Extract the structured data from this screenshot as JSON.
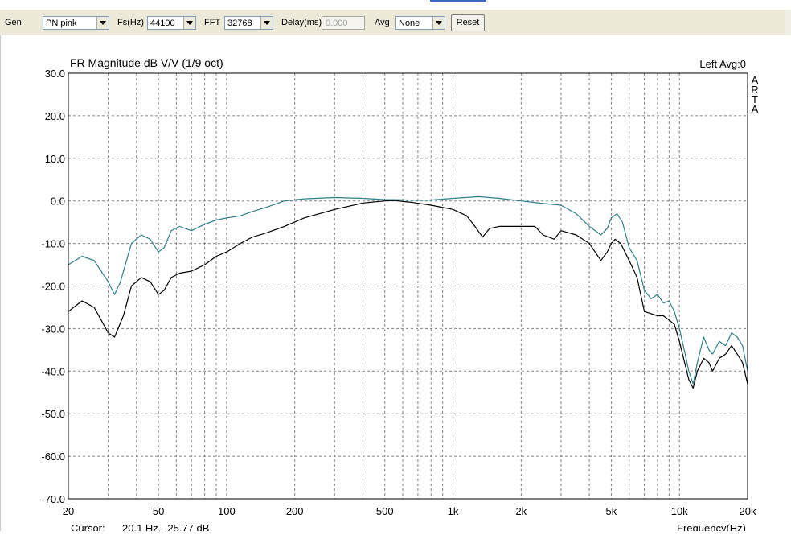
{
  "toolbar": {
    "gen_label": "Gen",
    "gen_value": "PN pink",
    "fs_label": "Fs(Hz)",
    "fs_value": "44100",
    "fft_label": "FFT",
    "fft_value": "32768",
    "delay_label": "Delay(ms)",
    "delay_value": "0.000",
    "avg_label": "Avg",
    "avg_value": "None",
    "reset_label": "Reset"
  },
  "chart": {
    "title": "FR Magnitude dB V/V (1/9 oct)",
    "status": "Left  Avg:0",
    "watermark": [
      "A",
      "R",
      "T",
      "A"
    ],
    "cursor_label": "Cursor:",
    "cursor_value": "20.1 Hz, -25.77 dB",
    "xlabel": "Frequency(Hz)"
  },
  "colors": {
    "grid": "#808080",
    "series_black": "#000000",
    "series_teal": "#2e7f86",
    "axis": "#000000"
  },
  "chart_data": {
    "type": "line",
    "title": "FR Magnitude dB V/V (1/9 oct)",
    "xlabel": "Frequency(Hz)",
    "ylabel": "",
    "xscale": "log",
    "xlim": [
      20,
      20000
    ],
    "ylim": [
      -70,
      30
    ],
    "grid": true,
    "x_ticks": [
      20,
      50,
      100,
      200,
      500,
      1000,
      2000,
      5000,
      10000,
      20000
    ],
    "x_tick_labels": [
      "20",
      "50",
      "100",
      "200",
      "500",
      "1k",
      "2k",
      "5k",
      "10k",
      "20k"
    ],
    "y_ticks": [
      30,
      20,
      10,
      0,
      -10,
      -20,
      -30,
      -40,
      -50,
      -60,
      -70
    ],
    "y_tick_labels": [
      "30.0",
      "20.0",
      "10.0",
      "0.0",
      "-10.0",
      "-20.0",
      "-30.0",
      "-40.0",
      "-50.0",
      "-60.0",
      "-70.0"
    ],
    "series": [
      {
        "color": "#2e7f86",
        "points": [
          [
            20,
            -15
          ],
          [
            23,
            -13
          ],
          [
            26,
            -14
          ],
          [
            30,
            -19
          ],
          [
            32,
            -22
          ],
          [
            34,
            -19
          ],
          [
            38,
            -10
          ],
          [
            42,
            -8
          ],
          [
            46,
            -9
          ],
          [
            50,
            -12
          ],
          [
            53,
            -11
          ],
          [
            57,
            -7
          ],
          [
            62,
            -6
          ],
          [
            70,
            -7
          ],
          [
            80,
            -5.5
          ],
          [
            90,
            -4.5
          ],
          [
            100,
            -4
          ],
          [
            115,
            -3.5
          ],
          [
            130,
            -2.5
          ],
          [
            150,
            -1.5
          ],
          [
            180,
            0
          ],
          [
            220,
            0.5
          ],
          [
            300,
            0.8
          ],
          [
            400,
            0.6
          ],
          [
            500,
            0.3
          ],
          [
            550,
            0.3
          ],
          [
            650,
            0.2
          ],
          [
            800,
            0.2
          ],
          [
            1000,
            0.6
          ],
          [
            1300,
            1
          ],
          [
            1600,
            0.6
          ],
          [
            2000,
            0
          ],
          [
            2500,
            -0.6
          ],
          [
            3000,
            -1
          ],
          [
            3500,
            -3
          ],
          [
            4000,
            -6
          ],
          [
            4500,
            -8
          ],
          [
            4800,
            -6.5
          ],
          [
            5000,
            -4
          ],
          [
            5300,
            -3
          ],
          [
            5600,
            -5
          ],
          [
            6000,
            -11
          ],
          [
            6500,
            -14
          ],
          [
            7000,
            -21
          ],
          [
            7500,
            -23
          ],
          [
            8000,
            -22
          ],
          [
            8500,
            -24
          ],
          [
            9000,
            -23.5
          ],
          [
            9500,
            -26
          ],
          [
            10000,
            -30
          ],
          [
            10500,
            -35
          ],
          [
            11000,
            -40
          ],
          [
            11500,
            -43
          ],
          [
            12000,
            -38
          ],
          [
            12800,
            -32
          ],
          [
            13500,
            -35
          ],
          [
            14000,
            -36
          ],
          [
            15000,
            -33
          ],
          [
            16000,
            -34
          ],
          [
            17000,
            -31
          ],
          [
            18000,
            -32
          ],
          [
            19000,
            -34
          ],
          [
            20000,
            -40
          ]
        ]
      },
      {
        "color": "#000000",
        "points": [
          [
            20,
            -26
          ],
          [
            23,
            -23.5
          ],
          [
            26,
            -25
          ],
          [
            30,
            -31
          ],
          [
            32,
            -32
          ],
          [
            35,
            -27
          ],
          [
            38,
            -20
          ],
          [
            42,
            -18
          ],
          [
            46,
            -19
          ],
          [
            50,
            -22
          ],
          [
            53,
            -21
          ],
          [
            57,
            -18
          ],
          [
            62,
            -17
          ],
          [
            70,
            -16.5
          ],
          [
            80,
            -15
          ],
          [
            90,
            -13
          ],
          [
            100,
            -12
          ],
          [
            115,
            -10
          ],
          [
            130,
            -8.5
          ],
          [
            150,
            -7.5
          ],
          [
            180,
            -6
          ],
          [
            220,
            -4
          ],
          [
            300,
            -2
          ],
          [
            400,
            -0.5
          ],
          [
            500,
            0
          ],
          [
            550,
            0.1
          ],
          [
            650,
            -0.3
          ],
          [
            800,
            -1
          ],
          [
            1000,
            -2
          ],
          [
            1150,
            -3.5
          ],
          [
            1250,
            -6
          ],
          [
            1350,
            -8.5
          ],
          [
            1450,
            -6.5
          ],
          [
            1600,
            -6
          ],
          [
            2000,
            -6
          ],
          [
            2300,
            -6
          ],
          [
            2500,
            -8
          ],
          [
            2800,
            -9
          ],
          [
            3000,
            -7
          ],
          [
            3500,
            -8
          ],
          [
            4000,
            -10
          ],
          [
            4500,
            -14
          ],
          [
            4800,
            -12
          ],
          [
            5000,
            -10
          ],
          [
            5200,
            -9
          ],
          [
            5500,
            -10
          ],
          [
            6000,
            -14
          ],
          [
            6500,
            -18
          ],
          [
            7000,
            -26
          ],
          [
            7500,
            -26.5
          ],
          [
            8000,
            -27
          ],
          [
            8500,
            -27
          ],
          [
            9000,
            -28
          ],
          [
            9500,
            -29
          ],
          [
            10000,
            -33
          ],
          [
            11000,
            -42
          ],
          [
            11500,
            -44
          ],
          [
            12000,
            -40
          ],
          [
            12800,
            -37
          ],
          [
            13500,
            -38
          ],
          [
            14000,
            -40
          ],
          [
            15000,
            -37
          ],
          [
            16000,
            -36
          ],
          [
            17000,
            -34
          ],
          [
            18000,
            -36
          ],
          [
            19000,
            -38
          ],
          [
            20000,
            -43
          ]
        ]
      }
    ]
  }
}
